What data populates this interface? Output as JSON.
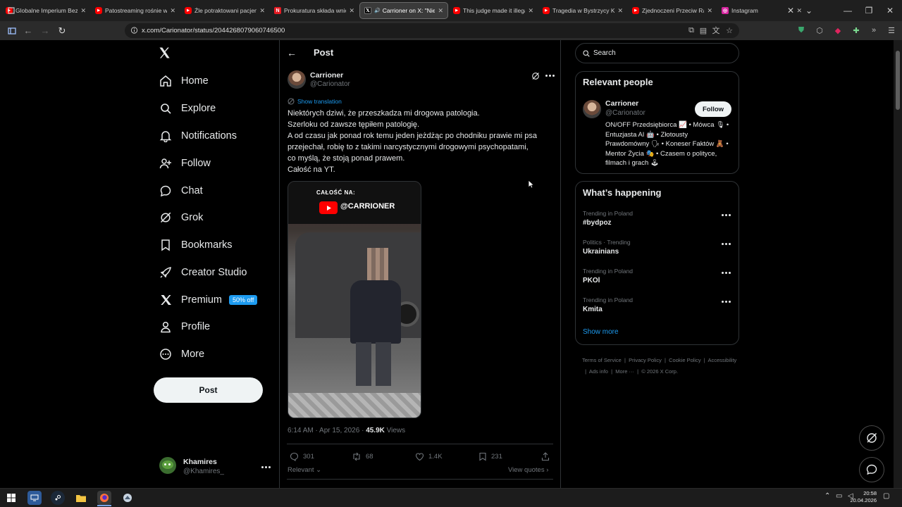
{
  "browser": {
    "tabs": [
      {
        "title": "Globalne Imperium Bezk",
        "fav_color": "#ff0000",
        "fav": "youtube-icon"
      },
      {
        "title": "Patostreaming rośnie w si",
        "fav_color": "#ff0000",
        "fav": "youtube-icon"
      },
      {
        "title": "Źle potraktowani pacjenc",
        "fav_color": "#ff0000",
        "fav": "youtube-icon"
      },
      {
        "title": "Prokuratura składa wnios",
        "fav_color": "#e51b23",
        "fav": "n-icon"
      },
      {
        "title": "Carrioner on X: \"Niek",
        "fav_color": "#000000",
        "fav": "x-icon"
      },
      {
        "title": "This judge made it illegal",
        "fav_color": "#ff0000",
        "fav": "youtube-icon"
      },
      {
        "title": "Tragedia w Bystrzycy Kło",
        "fav_color": "#ff0000",
        "fav": "youtube-icon"
      },
      {
        "title": "Zjednoczeni Przeciw Rasi",
        "fav_color": "#ff0000",
        "fav": "youtube-icon"
      },
      {
        "title": "Instagram",
        "fav_color": "#d6249f",
        "fav": "instagram-icon"
      }
    ],
    "active_tab_index": 4,
    "url": "x.com/Carionator/status/2044268079060746500"
  },
  "sidebar": {
    "items": [
      {
        "label": "Home",
        "icon": "home-icon"
      },
      {
        "label": "Explore",
        "icon": "search-icon"
      },
      {
        "label": "Notifications",
        "icon": "bell-icon"
      },
      {
        "label": "Follow",
        "icon": "person-plus-icon"
      },
      {
        "label": "Chat",
        "icon": "chat-icon"
      },
      {
        "label": "Grok",
        "icon": "grok-icon"
      },
      {
        "label": "Bookmarks",
        "icon": "bookmark-icon"
      },
      {
        "label": "Creator Studio",
        "icon": "rocket-icon"
      },
      {
        "label": "Premium",
        "icon": "x-logo-icon",
        "badge": "50% off"
      },
      {
        "label": "Profile",
        "icon": "person-icon"
      },
      {
        "label": "More",
        "icon": "more-circle-icon"
      }
    ],
    "post_button": "Post",
    "account": {
      "name": "Khamires",
      "handle": "@Khamires_"
    }
  },
  "post": {
    "header": "Post",
    "author": {
      "name": "Carrioner",
      "handle": "@Carionator"
    },
    "show_translation": "Show translation",
    "text_lines": [
      "Niektórych dziwi, że przeszkadza mi drogowa patologia.",
      "Szerloku od zawsze tępiłem patologię.",
      "A od czasu jak ponad rok temu jeden jeżdżąc po chodniku prawie mi psa",
      "przejechał, robię to z takimi narcystycznymi drogowymi psychopatami,",
      "co myślą, że stoją ponad prawem.",
      "Całość na YT."
    ],
    "media_overlay": {
      "label": "CAŁOŚĆ NA:",
      "channel": "@CARRIONER"
    },
    "timestamp": "6:14 AM · Apr 15, 2026 · ",
    "views_count": "45.9K",
    "views_label": " Views",
    "actions": {
      "replies": "301",
      "reposts": "68",
      "likes": "1.4K",
      "bookmarks": "231"
    },
    "sort_label": "Relevant",
    "view_quotes": "View quotes"
  },
  "right": {
    "search_placeholder": "Search",
    "relevant_title": "Relevant people",
    "person": {
      "name": "Carrioner",
      "handle": "@Carionator",
      "follow": "Follow",
      "bio": "ON/OFF Przedsiębiorca 📈 • Mówca 🎙 • Entuzjasta AI 🤖 • Złotousty Prawdomówny 🗣 • Koneser Faktów 🧸 • Mentor Życia 🎭 • Czasem o polityce, filmach i grach 🕹"
    },
    "happening_title": "What’s happening",
    "trends": [
      {
        "category": "Trending in Poland",
        "name": "#bydpoz"
      },
      {
        "category": "Politics · Trending",
        "name": "Ukrainians"
      },
      {
        "category": "Trending in Poland",
        "name": "PKOl"
      },
      {
        "category": "Trending in Poland",
        "name": "Kmita"
      }
    ],
    "show_more": "Show more",
    "footer_links": [
      "Terms of Service",
      "Privacy Policy",
      "Cookie Policy",
      "Accessibility",
      "Ads info",
      "More ···",
      "© 2026 X Corp."
    ]
  },
  "taskbar": {
    "time": "20:58",
    "date": "20.04.2026"
  }
}
